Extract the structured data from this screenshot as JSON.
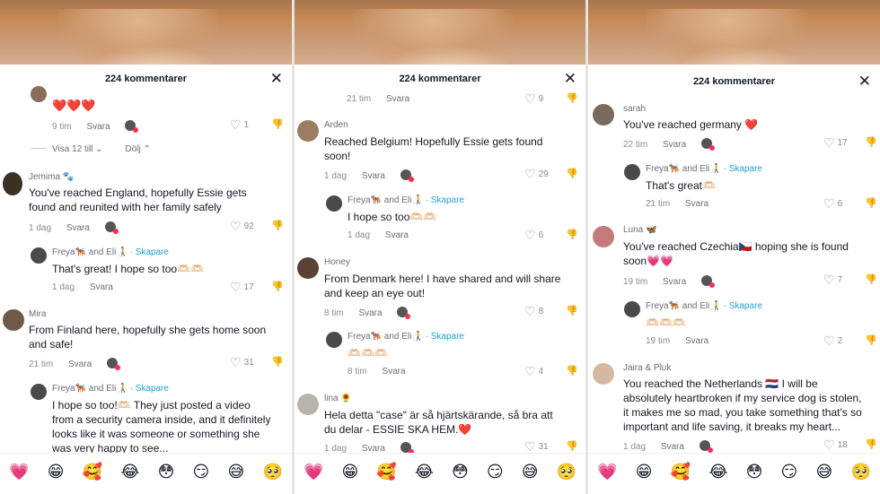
{
  "panels": [
    {
      "title": "224 kommentarer",
      "comments": [
        {
          "id": "p0c0",
          "user": "",
          "text": "❤️❤️❤️",
          "time": "9 tim",
          "reply": "Svara",
          "likes": "1"
        },
        {
          "id": "p0c1",
          "user": "Jemima 🐾",
          "text": "You've reached England, hopefully Essie gets\nfound and reunited with her family safely",
          "time": "1 dag",
          "reply": "Svara",
          "likes": "92"
        },
        {
          "id": "p0c2",
          "user": "Freya🐕‍🦺 and Eli🧑‍🦯",
          "creator": "· Skapare",
          "text": "That's great! I hope so too🫶🏻🫶🏻",
          "time": "1 dag",
          "reply": "Svara",
          "likes": "17"
        },
        {
          "id": "p0c3",
          "user": "Mira",
          "text": "From Finland here, hopefully she gets home soon\nand safe!",
          "time": "21 tim",
          "reply": "Svara",
          "likes": "31"
        },
        {
          "id": "p0c4",
          "user": "Freya🐕‍🦺 and Eli🧑‍🦯",
          "creator": "· Skapare",
          "text": "I hope so too!🫶🏻 They just posted a video\nfrom a security camera inside, and it definitely\nlooks like it was someone or something she\nwas very happy to see..."
        }
      ],
      "view_more": "Visa 12 till",
      "hide": "Dölj"
    },
    {
      "title": "224 kommentarer",
      "top_meta": {
        "time": "21 tim",
        "reply": "Svara",
        "likes": "9"
      },
      "comments": [
        {
          "id": "p1c0",
          "user": "Arden",
          "text": "Reached Belgium! Hopefully Essie gets found\nsoon!",
          "time": "1 dag",
          "reply": "Svara",
          "likes": "29"
        },
        {
          "id": "p1c1",
          "user": "Freya🐕‍🦺 and Eli🧑‍🦯",
          "creator": "· Skapare",
          "text": "I hope so too🫶🏻🫶🏻",
          "time": "1 dag",
          "reply": "Svara",
          "likes": "6"
        },
        {
          "id": "p1c2",
          "user": "Honey",
          "text": "From Denmark here! I have shared and will share\nand keep an eye out!",
          "time": "8 tim",
          "reply": "Svara",
          "likes": "8"
        },
        {
          "id": "p1c3",
          "user": "Freya🐕‍🦺 and Eli🧑‍🦯",
          "creator": "· Skapare",
          "text": "🫶🏻🫶🏻🫶🏻",
          "time": "8 tim",
          "reply": "Svara",
          "likes": "4"
        },
        {
          "id": "p1c4",
          "user": "lina 🌻",
          "text": "Hela detta \"case\" är så hjärtskärande, så bra att\ndu delar - ESSIE SKA HEM.❤️",
          "time": "1 dag",
          "reply": "Svara",
          "likes": "31"
        }
      ]
    },
    {
      "title": "224 kommentarer",
      "comments": [
        {
          "id": "p2c0",
          "user": "sarah",
          "text": "You've reached germany ❤️",
          "time": "22 tim",
          "reply": "Svara",
          "likes": "17"
        },
        {
          "id": "p2c1",
          "user": "Freya🐕‍🦺 and Eli🧑‍🦯",
          "creator": "· Skapare",
          "text": "That's great🫶🏻",
          "time": "21 tim",
          "reply": "Svara",
          "likes": "6"
        },
        {
          "id": "p2c2",
          "user": "Luna 🦋",
          "text": "You've reached Czechia🇨🇿 hoping she is found\nsoon💗💗",
          "time": "19 tim",
          "reply": "Svara",
          "likes": "7"
        },
        {
          "id": "p2c3",
          "user": "Freya🐕‍🦺 and Eli🧑‍🦯",
          "creator": "· Skapare",
          "text": "🫶🏻🫶🏻🫶🏻",
          "time": "19 tim",
          "reply": "Svara",
          "likes": "2"
        },
        {
          "id": "p2c4",
          "user": "Jaira & Pluk",
          "text": "You reached the Netherlands 🇳🇱 I will be\nabsolutely heartbroken if my service dog is stolen,\nit makes me so mad, you take something that's so\nimportant and life saving, it breaks my heart...",
          "time": "1 dag",
          "reply": "Svara",
          "likes": "18"
        }
      ]
    }
  ],
  "emoji_bar": [
    "💗",
    "😁",
    "🥰",
    "😂",
    "😳",
    "😏",
    "😅",
    "🥺"
  ],
  "icons": {
    "heart": "heart-outline-icon",
    "dislike": "thumbs-down-icon",
    "close": "close-icon"
  },
  "colors": {
    "creator": "#20a0d6",
    "muted": "#8a8b91",
    "text": "#161823"
  }
}
